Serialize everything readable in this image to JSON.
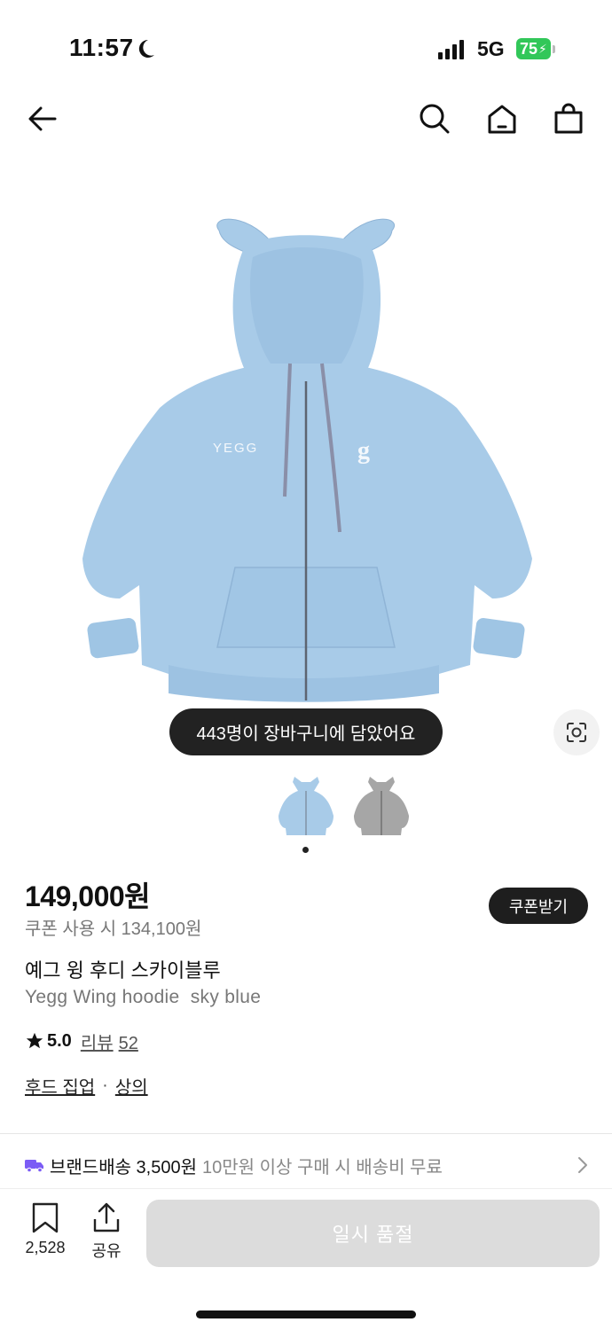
{
  "status_bar": {
    "time": "11:57",
    "network": "5G",
    "battery": "75"
  },
  "product": {
    "toast": "443명이 장바구니에 담았어요",
    "price": "149,000원",
    "coupon_price": "쿠폰 사용 시 134,100원",
    "coupon_button": "쿠폰받기",
    "name_ko": "예그 윙 후디 스카이블루",
    "name_en": "Yegg Wing hoodie  sky blue",
    "rating": "5.0",
    "review_label": "리뷰",
    "review_count": "52",
    "category_1": "후드 집업",
    "category_separator": "·",
    "category_2": "상의",
    "image_logo_text": "YEGG"
  },
  "shipping": {
    "label": "브랜드배송 3,500원",
    "note": "10만원 이상 구매 시 배송비 무료"
  },
  "bottom_bar": {
    "like_count": "2,528",
    "share_label": "공유",
    "cta_label": "일시 품절"
  },
  "colors": {
    "hoodie_blue": "#a8cbe8",
    "hoodie_gray": "#a6a6a6",
    "battery_green": "#32c759",
    "delivery_purple": "#7b5cf5"
  },
  "icons": [
    "back-arrow-icon",
    "search-icon",
    "home-icon",
    "shopping-bag-icon",
    "lens-icon",
    "star-icon",
    "truck-icon",
    "chevron-right-icon",
    "bookmark-icon",
    "share-icon"
  ]
}
